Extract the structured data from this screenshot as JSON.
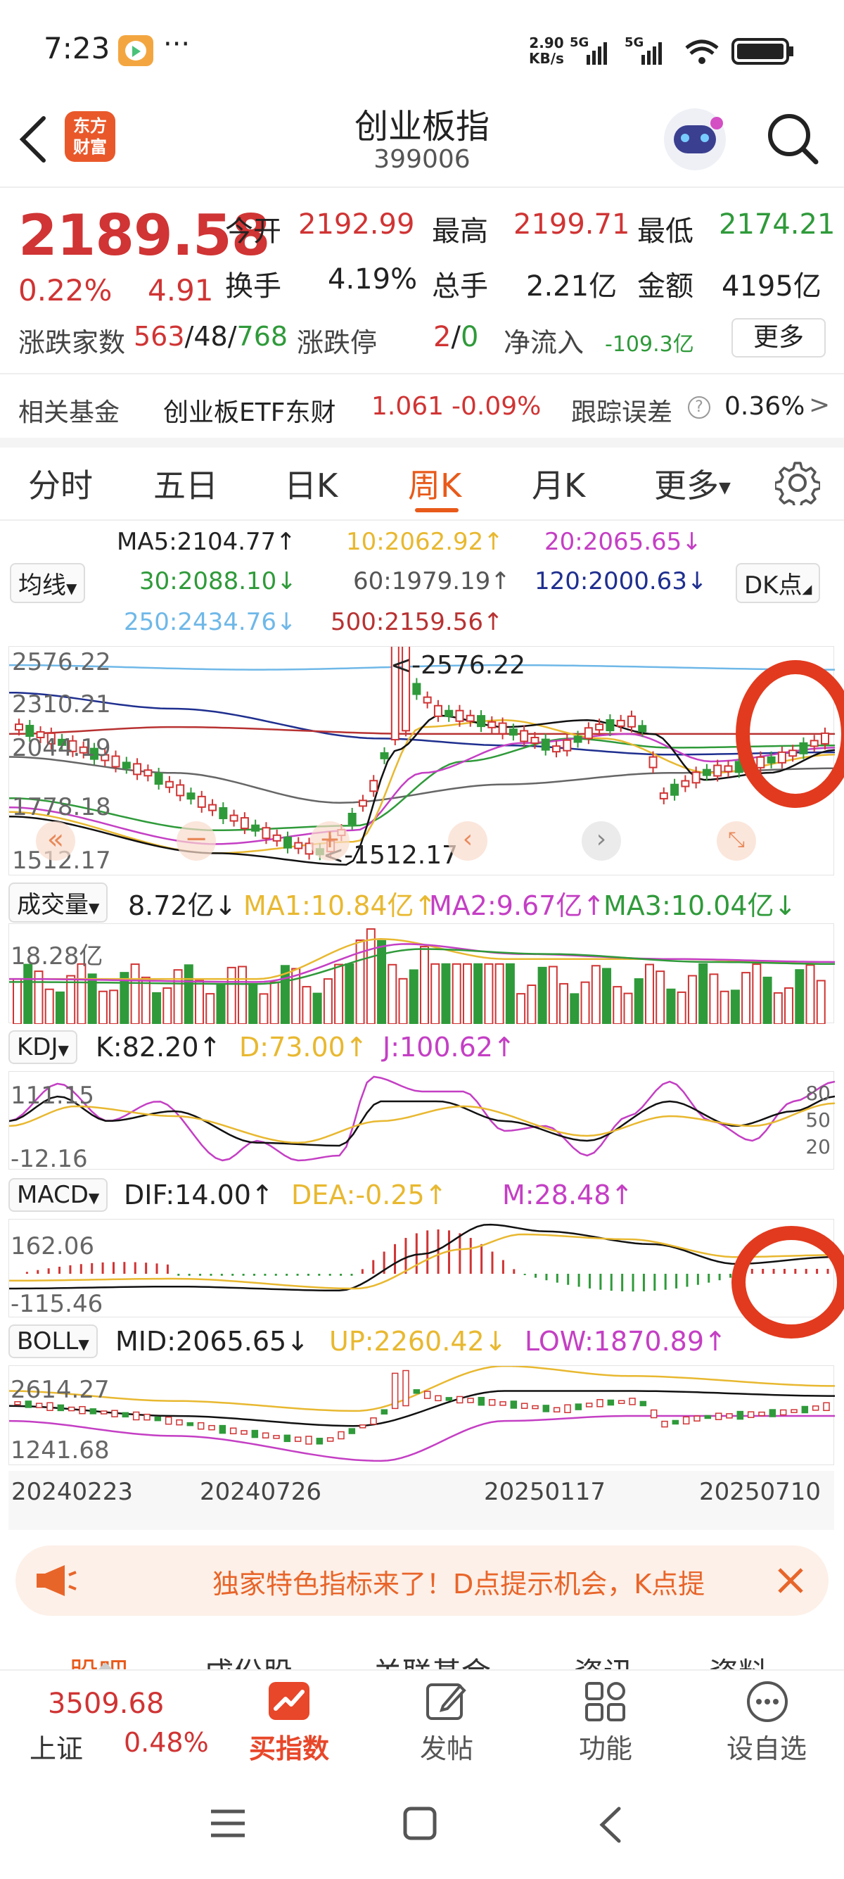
{
  "status": {
    "time": "7:23",
    "dots": "···",
    "speed_top": "2.90",
    "speed_bottom": "KB/s",
    "net1": "5G",
    "net2": "5G"
  },
  "header": {
    "title": "创业板指",
    "code": "399006",
    "logo_line1": "东方",
    "logo_line2": "财富"
  },
  "quote": {
    "price": "2189.58",
    "change_pct": "0.22%",
    "change": "4.91",
    "open_label": "今开",
    "open": "2192.99",
    "high_label": "最高",
    "high": "2199.71",
    "low_label": "最低",
    "low": "2174.21",
    "turnover_label": "换手",
    "turnover": "4.19%",
    "volume_label": "总手",
    "volume": "2.21亿",
    "amount_label": "金额",
    "amount": "4195亿",
    "breadth_label": "涨跌家数",
    "up": "563",
    "flat": "48",
    "down": "768",
    "sep": "/",
    "limit_label": "涨跌停",
    "limit_up": "2",
    "limit_down": "0",
    "inflow_label": "净流入",
    "inflow": "-109.3亿",
    "more": "更多"
  },
  "fund": {
    "label": "相关基金",
    "name": "创业板ETF东财",
    "price": "1.061",
    "pct": "-0.09%",
    "err_label": "跟踪误差",
    "help": "?",
    "err": "0.36%",
    "arrow": ">"
  },
  "tabs": [
    "分时",
    "五日",
    "日K",
    "周K",
    "月K",
    "更多"
  ],
  "ma": {
    "selector": "均线",
    "dk": "DK点",
    "ma5": "MA5:2104.77↑",
    "ma10": "10:2062.92↑",
    "ma20": "20:2065.65↓",
    "ma30": "30:2088.10↓",
    "ma60": "60:1979.19↑",
    "ma120": "120:2000.63↓",
    "ma250": "250:2434.76↓",
    "ma500": "500:2159.56↑"
  },
  "main_chart": {
    "y_top": "2576.22",
    "y2": "2310.21",
    "y3": "2044.19",
    "y4": "1778.18",
    "y_bottom": "1512.17",
    "hi_label": "<-2576.22",
    "lo_label": "<-1512.17"
  },
  "vol": {
    "selector": "成交量",
    "val": "8.72亿↓",
    "ma1": "MA1:10.84亿↑",
    "ma2": "MA2:9.67亿↑",
    "ma3": "MA3:10.04亿↓",
    "y_top": "18.28亿"
  },
  "kdj": {
    "selector": "KDJ",
    "k": "K:82.20↑",
    "d": "D:73.00↑",
    "j": "J:100.62↑",
    "y_top": "111.15",
    "y_bottom": "-12.16",
    "r80": "80",
    "r50": "50",
    "r20": "20"
  },
  "macd": {
    "selector": "MACD",
    "dif": "DIF:14.00↑",
    "dea": "DEA:-0.25↑",
    "m": "M:28.48↑",
    "y_top": "162.06",
    "y_bottom": "-115.46"
  },
  "boll": {
    "selector": "BOLL",
    "mid": "MID:2065.65↓",
    "up": "UP:2260.42↓",
    "low": "LOW:1870.89↑",
    "y_top": "2614.27",
    "y_bottom": "1241.68"
  },
  "dates": [
    "20240223",
    "20240726",
    "20250117",
    "20250710"
  ],
  "banner": {
    "text": "独家特色指标来了！D点提示机会，K点提"
  },
  "subtabs": [
    "股吧",
    "成份股",
    "关联基金",
    "资讯",
    "资料"
  ],
  "bottom_nav": {
    "index_value": "3509.68",
    "index_name": "上证",
    "index_pct": "0.48%",
    "buy": "买指数",
    "post": "发帖",
    "func": "功能",
    "fav": "设自选"
  },
  "colors": {
    "red": "#d03434",
    "green": "#2f9a3a",
    "accent": "#e85a1a",
    "yellow": "#e8b830",
    "magenta": "#c43fc4",
    "navy": "#1f2f8f",
    "skyblue": "#6fb8e8"
  }
}
